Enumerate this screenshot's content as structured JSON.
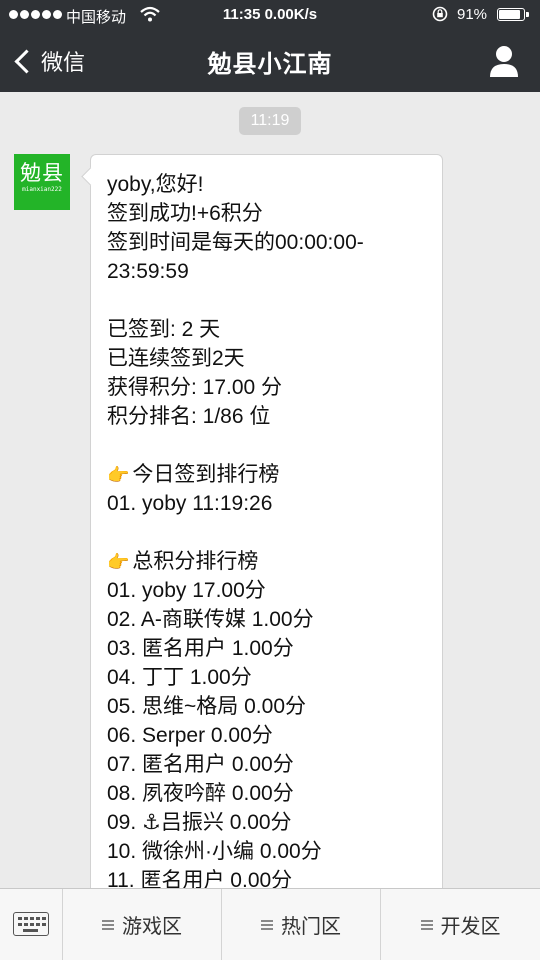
{
  "status_bar": {
    "carrier": "中国移动",
    "time": "11:35 0.00K/s",
    "battery": "91%",
    "battery_level": 0.91,
    "icons": [
      "signal-dots-icon",
      "wifi-icon",
      "rotation-lock-icon",
      "battery-icon"
    ]
  },
  "nav": {
    "back_label": "微信",
    "title": "勉县小江南",
    "icons": [
      "back-chevron-icon",
      "profile-icon"
    ]
  },
  "chat": {
    "timestamp": "11:19",
    "avatar": {
      "name": "勉县",
      "handle": "mianxian222",
      "color": "#23b428"
    },
    "message": {
      "greeting": "yoby,您好!",
      "signin_success": "签到成功!+6积分",
      "signin_time_line1": "签到时间是每天的00:00:00-",
      "signin_time_line2": "23:59:59",
      "days_signed": "已签到: 2 天",
      "consecutive": "已连续签到2天",
      "points": "获得积分: 17.00 分",
      "rank": "积分排名: 1/86 位",
      "today_emoji": "👉",
      "today_title": "今日签到排行榜",
      "today_list": [
        "01. yoby 11:19:26"
      ],
      "total_emoji": "👉",
      "total_title": "总积分排行榜",
      "total_list": [
        "01. yoby 17.00分",
        "02. A-商联传媒 1.00分",
        "03. 匿名用户 1.00分",
        "04. 丁丁 1.00分",
        "05. 思维~格局 0.00分",
        "06. Serper 0.00分",
        "07. 匿名用户 0.00分",
        "08. 夙夜吟醉 0.00分",
        "09. ⚓吕振兴 0.00分",
        "10. 微徐州·小编 0.00分",
        "11. 匿名用户 0.00分"
      ]
    }
  },
  "bottom_menu": {
    "keyboard_icon": "keyboard-icon",
    "tabs": [
      {
        "label": "游戏区",
        "icon": "menu-lines-icon"
      },
      {
        "label": "热门区",
        "icon": "menu-lines-icon"
      },
      {
        "label": "开发区",
        "icon": "menu-lines-icon"
      }
    ]
  },
  "colors": {
    "header_bg": "#2f3236",
    "chat_bg": "#ebebeb",
    "bubble_bg": "#ffffff",
    "avatar_green": "#23b428",
    "timestamp_bg": "#cfcfcf"
  }
}
